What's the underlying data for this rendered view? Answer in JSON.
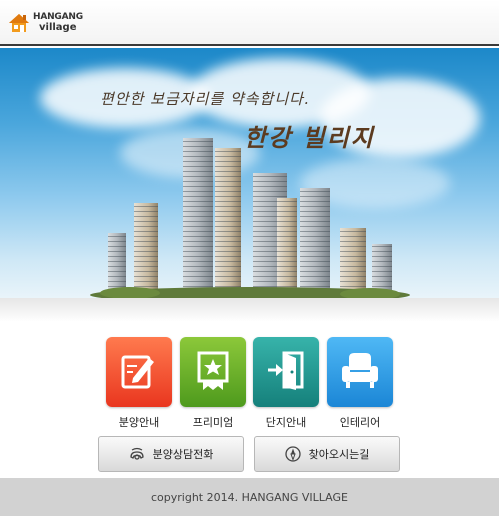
{
  "header": {
    "logo_top": "HANGANG",
    "logo_bottom": "village"
  },
  "hero": {
    "slogan": "편안한 보금자리를 약속합니다.",
    "title": "한강 빌리지"
  },
  "menu": [
    {
      "label": "분양안내",
      "icon": "pencil-note-icon",
      "color": "#e9361f"
    },
    {
      "label": "프리미엄",
      "icon": "award-ribbon-icon",
      "color": "#4e9a1d"
    },
    {
      "label": "단지안내",
      "icon": "door-enter-icon",
      "color": "#15807b"
    },
    {
      "label": "인테리어",
      "icon": "armchair-icon",
      "color": "#1b86d6"
    }
  ],
  "buttons": {
    "call": "분양상담전화",
    "directions": "찾아오시는길"
  },
  "footer": {
    "copyright": "copyright 2014. HANGANG VILLAGE"
  }
}
